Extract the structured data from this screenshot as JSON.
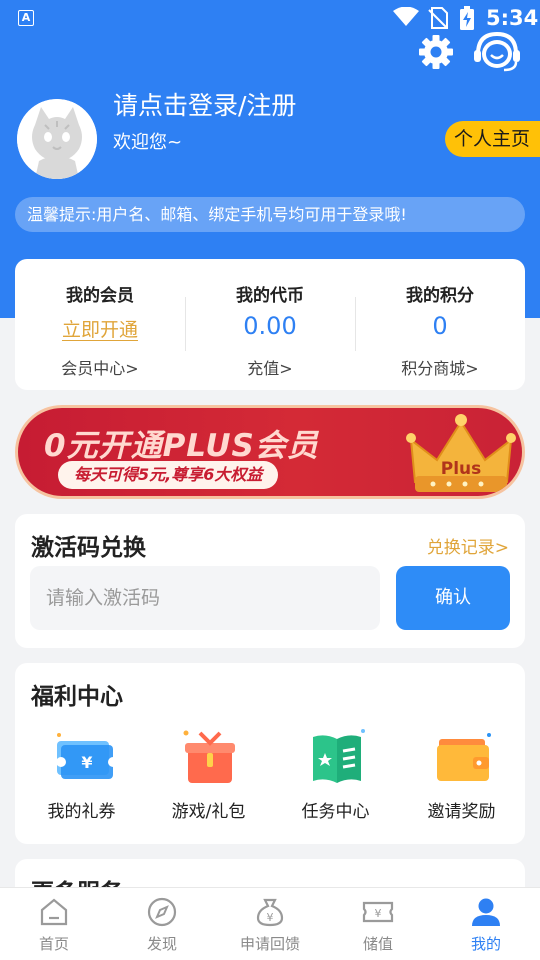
{
  "status_bar": {
    "time": "5:34"
  },
  "header": {
    "login_prompt": "请点击登录/注册",
    "welcome": "欢迎您~",
    "homepage_button": "个人主页",
    "tip": "温馨提示:用户名、邮箱、绑定手机号均可用于登录哦!"
  },
  "stats": [
    {
      "label": "我的会员",
      "value": "立即开通",
      "sub": "会员中心>"
    },
    {
      "label": "我的代币",
      "value": "0.00",
      "sub": "充值>"
    },
    {
      "label": "我的积分",
      "value": "0",
      "sub": "积分商城>"
    }
  ],
  "banner": {
    "title": "0元开通PLUS会员",
    "subtitle": "每天可得5元,尊享6大权益",
    "badge": "Plus"
  },
  "redeem": {
    "title": "激活码兑换",
    "record_link": "兑换记录>",
    "placeholder": "请输入激活码",
    "confirm": "确认"
  },
  "welfare": {
    "title": "福利中心",
    "items": [
      {
        "label": "我的礼券",
        "icon": "ticket-icon"
      },
      {
        "label": "游戏/礼包",
        "icon": "gift-icon"
      },
      {
        "label": "任务中心",
        "icon": "task-book-icon"
      },
      {
        "label": "邀请奖励",
        "icon": "wallet-icon"
      }
    ]
  },
  "more": {
    "title": "更多服务"
  },
  "tabs": [
    {
      "label": "首页",
      "icon": "home-icon"
    },
    {
      "label": "发现",
      "icon": "compass-icon"
    },
    {
      "label": "申请回馈",
      "icon": "money-bag-icon"
    },
    {
      "label": "储值",
      "icon": "voucher-icon"
    },
    {
      "label": "我的",
      "icon": "user-icon",
      "active": true
    }
  ],
  "colors": {
    "primary": "#2e80f3",
    "accent": "#ffc107",
    "link_gold": "#e0a53a",
    "banner_red": "#c61c33"
  }
}
